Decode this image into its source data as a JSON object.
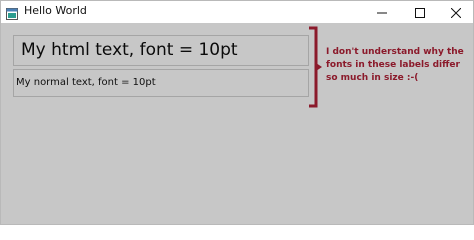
{
  "window": {
    "title": "Hello World"
  },
  "labels": {
    "html_text": "My html text, font = 10pt",
    "normal_text": "My normal text, font = 10pt"
  },
  "annotation": {
    "text": "I don't understand why the fonts in these labels differ so much in size :-(",
    "color": "#8b1a2b"
  },
  "icons": {
    "app": "app-window-icon",
    "minimize": "minimize-icon",
    "maximize": "maximize-icon",
    "close": "close-icon",
    "bracket": "bracket-arrow-icon"
  }
}
